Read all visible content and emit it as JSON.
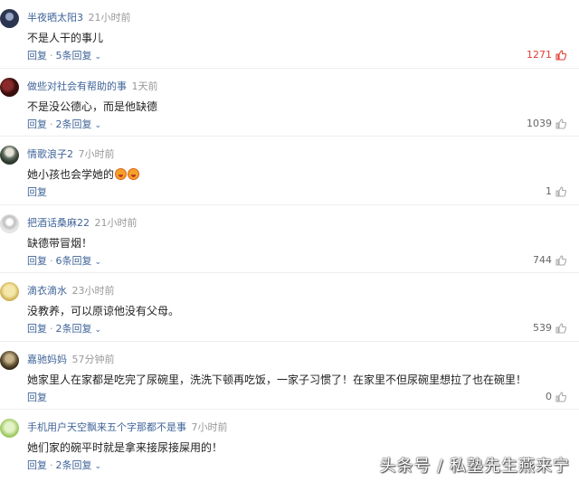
{
  "comments": [
    {
      "user": "半夜晒太阳3",
      "time": "21小时前",
      "text": "不是人干的事儿",
      "reply_label": "回复",
      "sub_replies": "5条回复",
      "likes": "1271",
      "liked": true,
      "avatar_color": "#3a4a6a"
    },
    {
      "user": "做些对社会有帮助的事",
      "time": "1天前",
      "text": "不是没公德心，而是他缺德",
      "reply_label": "回复",
      "sub_replies": "2条回复",
      "likes": "1039",
      "liked": false,
      "avatar_color": "#5a1a1a"
    },
    {
      "user": "情歌浪子2",
      "time": "7小时前",
      "text": "她小孩也会学她的",
      "reply_label": "回复",
      "sub_replies": "",
      "likes": "1",
      "liked": false,
      "avatar_color": "#6b7b6b"
    },
    {
      "user": "把酒话桑麻22",
      "time": "21小时前",
      "text": "缺德带冒烟！",
      "reply_label": "回复",
      "sub_replies": "6条回复",
      "likes": "744",
      "liked": false,
      "avatar_color": "#d8d8d8"
    },
    {
      "user": "滴衣滴水",
      "time": "23小时前",
      "text": "没教养，可以原谅他没有父母。",
      "reply_label": "回复",
      "sub_replies": "2条回复",
      "likes": "539",
      "liked": false,
      "avatar_color": "#d9c27a"
    },
    {
      "user": "嘉驰妈妈",
      "time": "57分钟前",
      "text": "她家里人在家都是吃完了尿碗里，洗洗下顿再吃饭，一家子习惯了！在家里不但尿碗里想拉了也在碗里！",
      "reply_label": "回复",
      "sub_replies": "",
      "likes": "0",
      "liked": false,
      "avatar_color": "#8a7a5a"
    },
    {
      "user": "手机用户天空飘来五个字那都不是事",
      "time": "7小时前",
      "text": "她们家的碗平时就是拿来接尿接屎用的！",
      "reply_label": "回复",
      "sub_replies": "2条回复",
      "likes": "",
      "liked": false,
      "avatar_color": "#b9d98a"
    }
  ],
  "watermark": "头条号 / 私塾先生燕来宁",
  "colors": {
    "username": "#406599",
    "time": "#999999",
    "liked": "#e33e33",
    "text": "#222222"
  }
}
